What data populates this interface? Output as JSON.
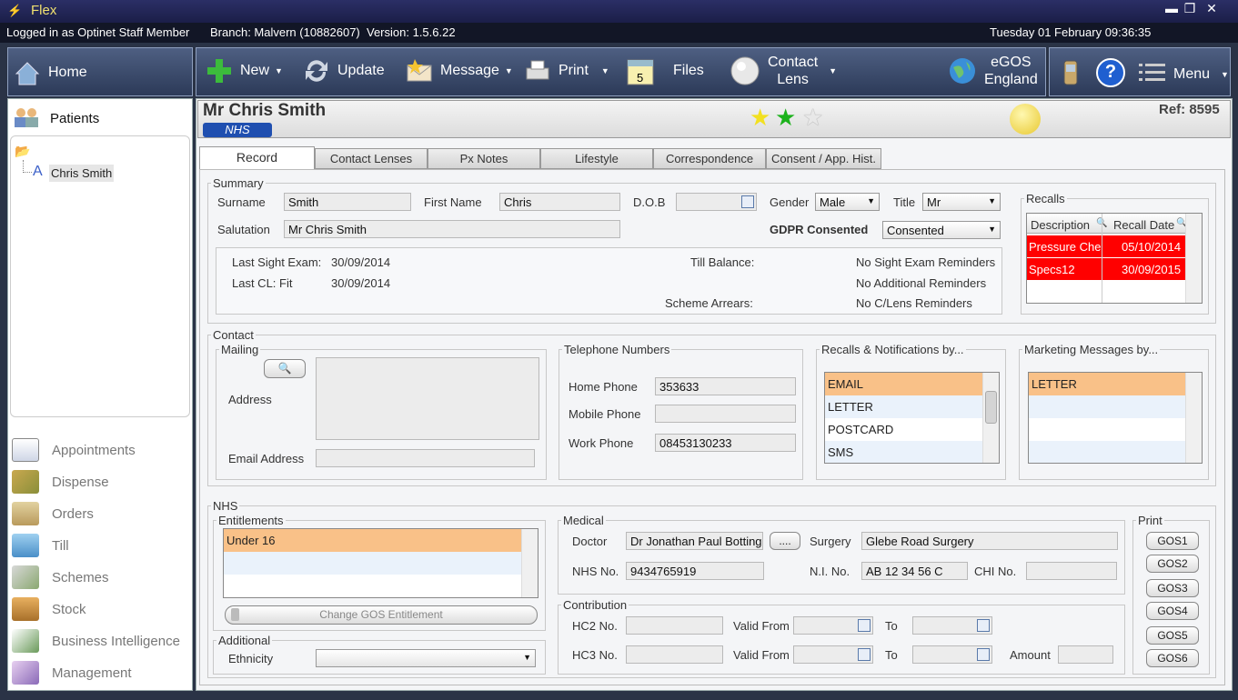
{
  "app": {
    "title": "Flex"
  },
  "status": {
    "user": "Logged in as Optinet Staff Member",
    "branch": "Branch: Malvern (10882607)",
    "version": "Version: 1.5.6.22",
    "datetime": "Tuesday 01 February 09:36:35"
  },
  "window": {
    "minimize": "▬",
    "restore": "❐",
    "close": "✕"
  },
  "toolbar": {
    "home": "Home",
    "new": "New",
    "update": "Update",
    "message": "Message",
    "print": "Print",
    "files": "Files",
    "contact_lens_1": "Contact",
    "contact_lens_2": "Lens",
    "egos_1": "eGOS",
    "egos_2": "England",
    "help": "?",
    "menu": "Menu"
  },
  "sidebar": {
    "patients": "Patients",
    "tree_item": "Chris Smith",
    "nav": [
      "Appointments",
      "Dispense",
      "Orders",
      "Till",
      "Schemes",
      "Stock",
      "Business Intelligence",
      "Management"
    ]
  },
  "patient": {
    "name": "Mr Chris Smith",
    "badge": "NHS",
    "ref": "Ref: 8595"
  },
  "tabs": [
    "Record",
    "Contact Lenses",
    "Px Notes",
    "Lifestyle",
    "Correspondence",
    "Consent / App. Hist."
  ],
  "summary": {
    "title": "Summary",
    "surname_label": "Surname",
    "surname": "Smith",
    "firstname_label": "First Name",
    "firstname": "Chris",
    "dob_label": "D.O.B",
    "dob": "",
    "gender_label": "Gender",
    "gender": "Male",
    "title_label": "Title",
    "title_value": "Mr",
    "salutation_label": "Salutation",
    "salutation": "Mr Chris Smith",
    "gdpr_label": "GDPR Consented",
    "gdpr": "Consented",
    "last_sight_label": "Last Sight Exam:",
    "last_sight": "30/09/2014",
    "last_cl_label": "Last CL:  Fit",
    "last_cl": "30/09/2014",
    "till_label": "Till Balance:",
    "scheme_label": "Scheme Arrears:",
    "reminder1": "No Sight Exam Reminders",
    "reminder2": "No Additional Reminders",
    "reminder3": "No C/Lens Reminders"
  },
  "recalls": {
    "title": "Recalls",
    "col1": "Description",
    "col2": "Recall Date",
    "rows": [
      {
        "desc": "Pressure Che",
        "date": "05/10/2014"
      },
      {
        "desc": "Specs12",
        "date": "30/09/2015"
      }
    ]
  },
  "contact": {
    "title": "Contact",
    "mailing": "Mailing",
    "address_label": "Address",
    "email_label": "Email Address",
    "phones_title": "Telephone Numbers",
    "home_label": "Home Phone",
    "home": "353633",
    "mobile_label": "Mobile Phone",
    "mobile": "",
    "work_label": "Work Phone",
    "work": "08453130233",
    "recalls_by": "Recalls & Notifications by...",
    "recall_opts": [
      "EMAIL",
      "LETTER",
      "POSTCARD",
      "SMS"
    ],
    "marketing_by": "Marketing Messages by...",
    "marketing_opts": [
      "LETTER"
    ]
  },
  "nhs": {
    "title": "NHS",
    "entitlements": "Entitlements",
    "entitlement_items": [
      "Under 16"
    ],
    "change_gos": "Change GOS Entitlement",
    "additional": "Additional",
    "ethnicity_label": "Ethnicity",
    "ethnicity": "",
    "medical": "Medical",
    "doctor_label": "Doctor",
    "doctor": "Dr Jonathan Paul Botting",
    "doc_btn": "....",
    "surgery_label": "Surgery",
    "surgery": "Glebe Road Surgery",
    "nhsno_label": "NHS No.",
    "nhsno": "9434765919",
    "ni_label": "N.I. No.",
    "ni": "AB 12 34 56 C",
    "chi_label": "CHI No.",
    "chi": "",
    "contribution": "Contribution",
    "hc2_label": "HC2 No.",
    "hc3_label": "HC3 No.",
    "valid_from": "Valid From",
    "to": "To",
    "amount": "Amount",
    "print": "Print",
    "gos": [
      "GOS1",
      "GOS2",
      "GOS3",
      "GOS4",
      "GOS5",
      "GOS6"
    ]
  },
  "colors": {
    "recall_red": "#ff0000",
    "selected_orange": "#f9c188"
  }
}
